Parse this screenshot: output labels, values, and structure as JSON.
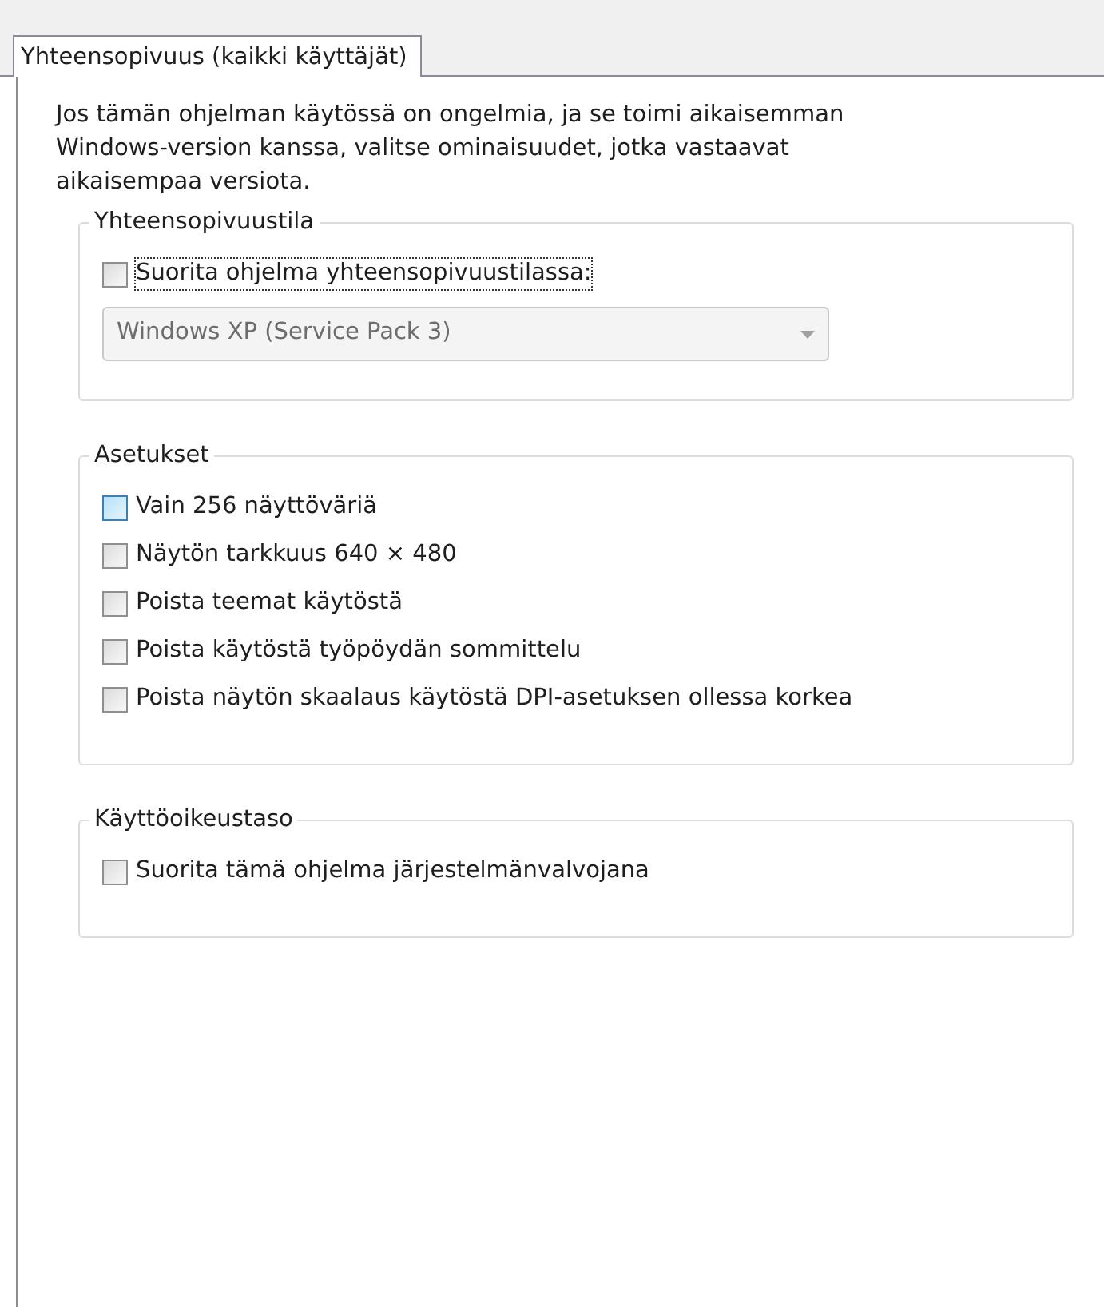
{
  "tabs": [
    {
      "label": "Yhteensopivuus (kaikki käyttäjät)",
      "selected": true
    }
  ],
  "intro": "Jos tämän ohjelman käytössä on ongelmia, ja se toimi aikaisemman Windows-version kanssa, valitse ominaisuudet, jotka vastaavat aikaisempaa versiota.",
  "groups": [
    {
      "title": "Yhteensopivuustila",
      "items": [
        {
          "kind": "checkbox",
          "label": "Suorita ohjelma yhteensopivuustilassa:",
          "checked": false,
          "hovered": false,
          "focused": true
        },
        {
          "kind": "dropdown",
          "value": "Windows XP (Service Pack 3)",
          "disabled": true
        }
      ]
    },
    {
      "title": "Asetukset",
      "items": [
        {
          "kind": "checkbox",
          "label": "Vain 256 näyttöväriä",
          "checked": false,
          "hovered": true,
          "focused": false
        },
        {
          "kind": "checkbox",
          "label": "Näytön tarkkuus 640 × 480",
          "checked": false,
          "hovered": false,
          "focused": false
        },
        {
          "kind": "checkbox",
          "label": "Poista teemat käytöstä",
          "checked": false,
          "hovered": false,
          "focused": false
        },
        {
          "kind": "checkbox",
          "label": "Poista käytöstä työpöydän sommittelu",
          "checked": false,
          "hovered": false,
          "focused": false
        },
        {
          "kind": "checkbox",
          "label": "Poista näytön skaalaus käytöstä DPI-asetuksen ollessa korkea",
          "checked": false,
          "hovered": false,
          "focused": false
        }
      ]
    },
    {
      "title": "Käyttöoikeustaso",
      "items": [
        {
          "kind": "checkbox",
          "label": "Suorita tämä ohjelma järjestelmänvalvojana",
          "checked": false,
          "hovered": false,
          "focused": false
        }
      ]
    }
  ]
}
